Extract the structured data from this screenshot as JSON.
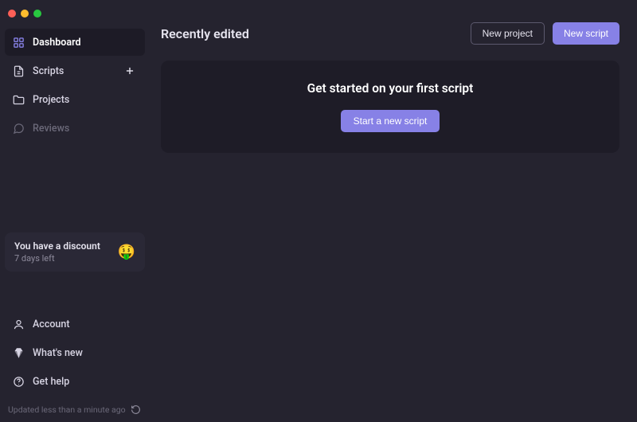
{
  "sidebar": {
    "items": [
      {
        "label": "Dashboard"
      },
      {
        "label": "Scripts"
      },
      {
        "label": "Projects"
      },
      {
        "label": "Reviews"
      }
    ],
    "promo": {
      "title": "You have a discount",
      "subtitle": "7 days left",
      "emoji": "🤑"
    },
    "bottom": [
      {
        "label": "Account"
      },
      {
        "label": "What's new"
      },
      {
        "label": "Get help"
      }
    ],
    "status": "Updated less than a minute ago"
  },
  "header": {
    "title": "Recently edited",
    "new_project": "New project",
    "new_script": "New script"
  },
  "empty_state": {
    "headline": "Get started on your first script",
    "cta": "Start a new script"
  },
  "colors": {
    "accent": "#8781e6",
    "bg": "#25232f",
    "panel": "#1e1c27"
  }
}
